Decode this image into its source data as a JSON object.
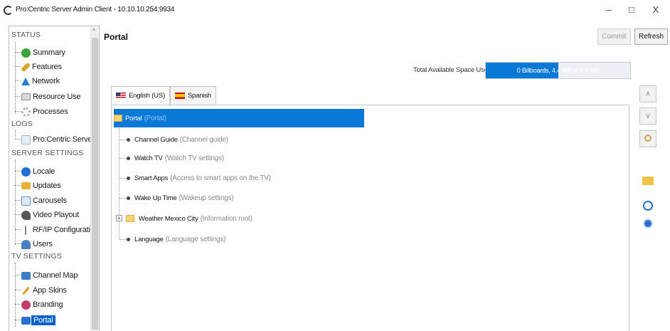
{
  "window": {
    "title": "Pro:Centric Server Admin Client - 10.10.10.254:9934",
    "minimize_glyph": "–",
    "maximize_glyph": "□",
    "close_glyph": "X"
  },
  "sidebar": {
    "sections": [
      {
        "label": "STATUS",
        "items": [
          {
            "label": "Summary",
            "icon": "check-icon",
            "color": "#3aa33a"
          },
          {
            "label": "Features",
            "icon": "key-icon",
            "color": "#d9a52b"
          },
          {
            "label": "Network",
            "icon": "network-icon",
            "color": "#2a7bd6"
          },
          {
            "label": "Resource Use",
            "icon": "monitor-icon",
            "color": "#8a8a8a"
          },
          {
            "label": "Processes",
            "icon": "gear-icon",
            "color": "#b0b0b0"
          }
        ]
      },
      {
        "label": "LOGS",
        "items": [
          {
            "label": "Pro:Centric Server",
            "icon": "log-icon",
            "color": "#9ab3cf"
          }
        ]
      },
      {
        "label": "SERVER SETTINGS",
        "items": [
          {
            "label": "Locale",
            "icon": "globe-icon",
            "color": "#1f6fd1"
          },
          {
            "label": "Updates",
            "icon": "folder-icon",
            "color": "#e8b23a"
          },
          {
            "label": "Carousels",
            "icon": "carousel-icon",
            "color": "#5b8ed0"
          },
          {
            "label": "Video Playout",
            "icon": "satellite-icon",
            "color": "#555555"
          },
          {
            "label": "RF/IP Configuration",
            "icon": "antenna-icon",
            "color": "#888888"
          },
          {
            "label": "Users",
            "icon": "users-icon",
            "color": "#4a7fc4"
          }
        ]
      },
      {
        "label": "TV SETTINGS",
        "items": [
          {
            "label": "Channel Map",
            "icon": "tv-icon",
            "color": "#3d7cc9"
          },
          {
            "label": "App Skins",
            "icon": "wand-icon",
            "color": "#e09a2a"
          },
          {
            "label": "Branding",
            "icon": "branding-icon",
            "color": "#c23b6a"
          },
          {
            "label": "Portal",
            "icon": "portal-icon",
            "color": "#2b6fd0",
            "selected": true
          }
        ]
      }
    ]
  },
  "main": {
    "title": "Portal",
    "commit_label": "Commit",
    "refresh_label": "Refresh",
    "space_label": "Total Available Space Used",
    "space_text": "0 Billboards, 4.4 MB of 8.8 MB",
    "space_used_fraction": 0.5,
    "tabs": [
      {
        "label": "English (US)",
        "flag": "us-flag-icon",
        "active": true
      },
      {
        "label": "Spanish",
        "flag": "spain-flag-icon",
        "active": false
      }
    ],
    "tree": {
      "root": {
        "name": "Portal",
        "desc": "(Portal)"
      },
      "children": [
        {
          "name": "Channel Guide",
          "desc": "(Channel guide)"
        },
        {
          "name": "Watch TV",
          "desc": "(Watch TV settings)"
        },
        {
          "name": "Smart Apps",
          "desc": "(Access to smart apps on the TV)"
        },
        {
          "name": "Wake Up Time",
          "desc": "(Wakeup settings)"
        },
        {
          "name": "Weather Mexico City",
          "desc": "(Information root)",
          "folder": true,
          "expandable": true
        },
        {
          "name": "Language",
          "desc": "(Language settings)"
        }
      ]
    },
    "side_toolbar": {
      "up_glyph": "∧",
      "down_glyph": "∨"
    }
  },
  "colors": {
    "accent": "#0a78d7",
    "selected_nav": "#0a63c9"
  }
}
